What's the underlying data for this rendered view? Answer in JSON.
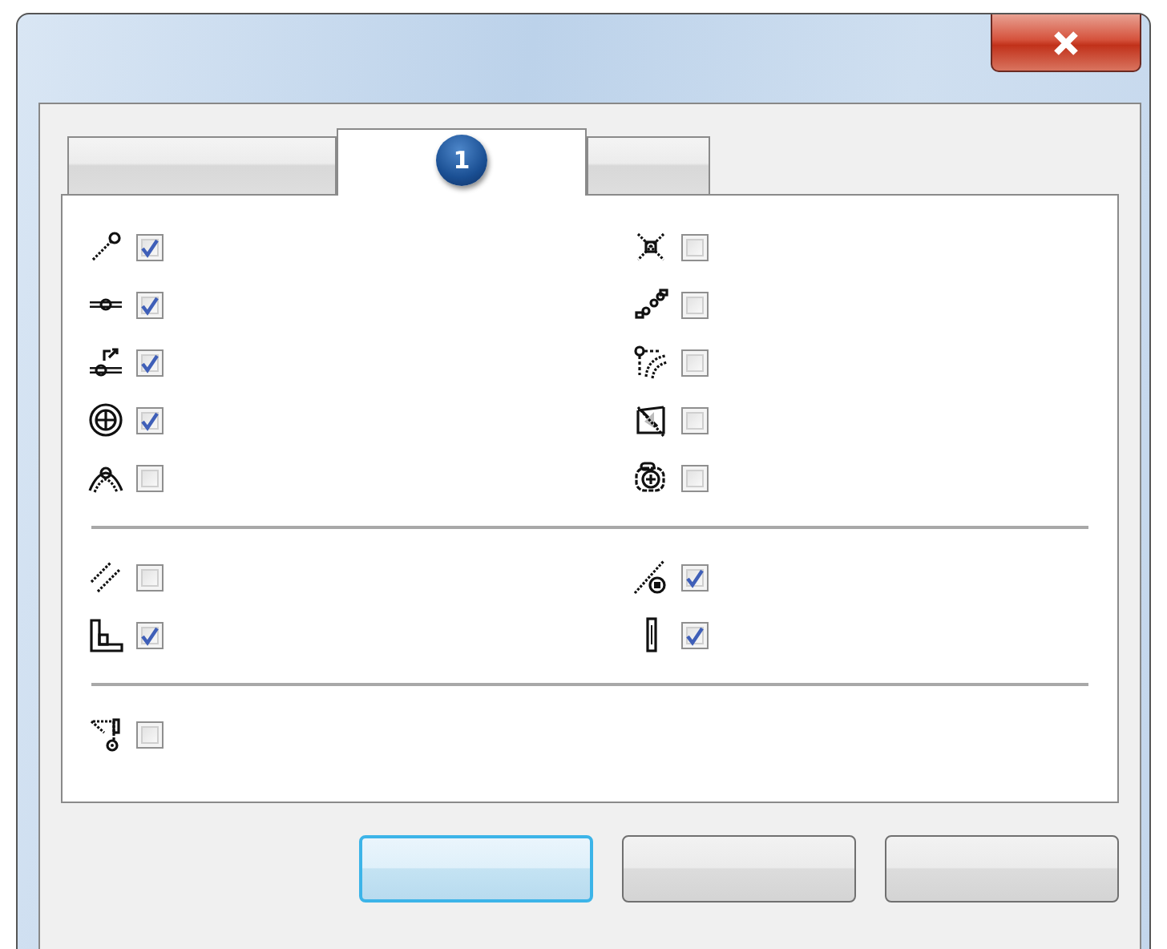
{
  "tabs": [
    {
      "selected": false
    },
    {
      "selected": true,
      "badge": "1"
    },
    {
      "selected": false
    }
  ],
  "sections": [
    {
      "items": [
        {
          "checked": true
        },
        {
          "checked": false
        },
        {
          "checked": true
        },
        {
          "checked": false
        },
        {
          "checked": true
        },
        {
          "checked": false
        },
        {
          "checked": true
        },
        {
          "checked": false
        },
        {
          "checked": false
        },
        {
          "checked": false
        }
      ]
    },
    {
      "items": [
        {
          "checked": false
        },
        {
          "checked": true
        },
        {
          "checked": true
        },
        {
          "checked": true
        }
      ]
    },
    {
      "items": [
        {
          "checked": false
        }
      ]
    }
  ],
  "buttons": [
    {
      "focused": true
    },
    {
      "focused": false
    },
    {
      "focused": false
    }
  ]
}
